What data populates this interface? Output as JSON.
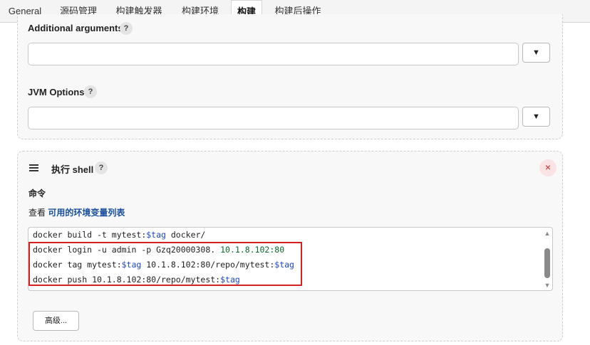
{
  "tabs": [
    {
      "label": "General"
    },
    {
      "label": "源码管理"
    },
    {
      "label": "构建触发器"
    },
    {
      "label": "构建环境"
    },
    {
      "label": "构建"
    },
    {
      "label": "构建后操作"
    }
  ],
  "active_tab": "构建",
  "section_gradle": {
    "additional_arguments_label": "Additional arguments",
    "jvm_options_label": "JVM Options",
    "help_glyph": "?",
    "dropdown_glyph": "▼"
  },
  "section_shell": {
    "title": "执行 shell",
    "help_glyph": "?",
    "close_glyph": "×",
    "command_label": "命令",
    "view_prefix": "查看",
    "env_link": "可用的环境变量列表",
    "code_lines": [
      [
        {
          "t": "docker build -t mytest:"
        },
        {
          "t": "$tag",
          "k": "var"
        },
        {
          "t": " docker/"
        }
      ],
      [
        {
          "t": "docker login -u admin -p Gzq20000308. "
        },
        {
          "t": "10.1.8.102:80",
          "k": "num"
        }
      ],
      [
        {
          "t": "docker tag mytest:"
        },
        {
          "t": "$tag",
          "k": "var"
        },
        {
          "t": " 10.1.8.102:80/repo/mytest:"
        },
        {
          "t": "$tag",
          "k": "var"
        }
      ],
      [
        {
          "t": "docker push 10.1.8.102:80/repo/mytest:"
        },
        {
          "t": "$tag",
          "k": "var"
        }
      ]
    ],
    "advanced_button": "高级..."
  },
  "colors": {
    "highlight_border": "#d32020",
    "link": "#1a4fa0",
    "variable": "#1b46c8"
  },
  "icons": {
    "drag_handle": "hamburger-icon",
    "close": "close-icon",
    "help": "help-icon",
    "dropdown": "chevron-down-icon"
  }
}
